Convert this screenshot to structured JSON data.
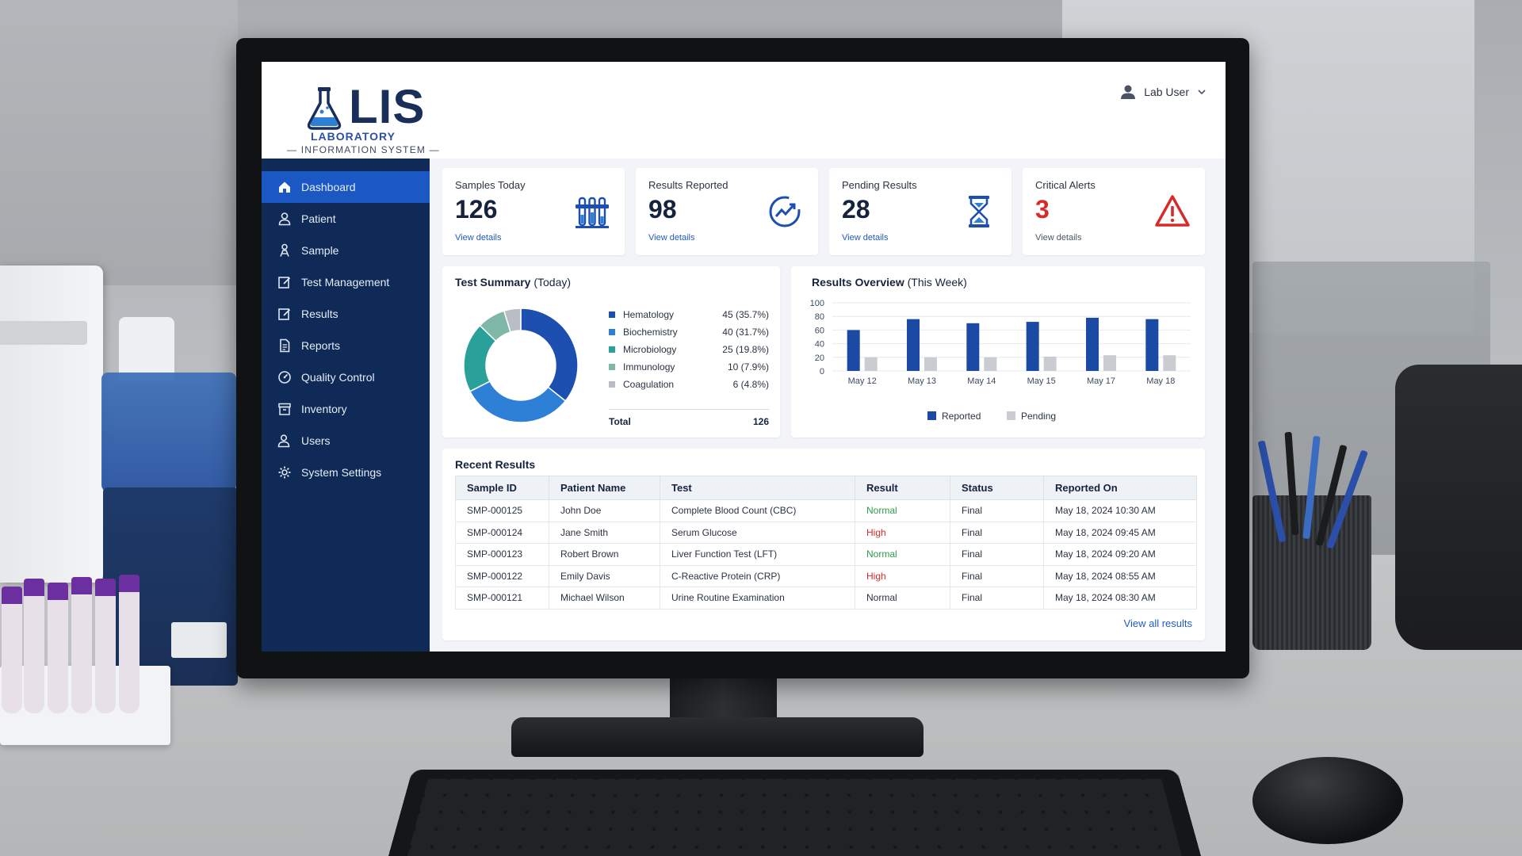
{
  "app": {
    "logo_text": "LIS",
    "logo_subtitle_1": "LABORATORY",
    "logo_subtitle_2": "INFORMATION SYSTEM"
  },
  "user": {
    "name": "Lab User",
    "icon": "user-icon",
    "menu_icon": "chevron-down-icon"
  },
  "sidebar": {
    "items": [
      {
        "label": "Dashboard",
        "icon": "home-icon",
        "active": true
      },
      {
        "label": "Patient",
        "icon": "user-icon"
      },
      {
        "label": "Sample",
        "icon": "sample-icon"
      },
      {
        "label": "Test Management",
        "icon": "edit-icon"
      },
      {
        "label": "Results",
        "icon": "edit-icon"
      },
      {
        "label": "Reports",
        "icon": "document-icon"
      },
      {
        "label": "Quality Control",
        "icon": "gauge-icon"
      },
      {
        "label": "Inventory",
        "icon": "archive-icon"
      },
      {
        "label": "Users",
        "icon": "users-icon"
      },
      {
        "label": "System Settings",
        "icon": "gear-icon"
      }
    ]
  },
  "kpis": [
    {
      "title": "Samples Today",
      "value": "126",
      "link": "View details",
      "icon": "test-tubes-icon"
    },
    {
      "title": "Results Reported",
      "value": "98",
      "link": "View details",
      "icon": "chart-check-icon"
    },
    {
      "title": "Pending Results",
      "value": "28",
      "link": "View details",
      "icon": "hourglass-icon"
    },
    {
      "title": "Critical Alerts",
      "value": "3",
      "link": "View details",
      "icon": "warning-icon"
    }
  ],
  "test_summary": {
    "title": "Test Summary",
    "title_suffix": "(Today)",
    "rows": [
      {
        "name": "Hematology",
        "value": "45 (35.7%)",
        "color": "#1c4fb0"
      },
      {
        "name": "Biochemistry",
        "value": "40 (31.7%)",
        "color": "#2e7fd6"
      },
      {
        "name": "Microbiology",
        "value": "25 (19.8%)",
        "color": "#2aa198"
      },
      {
        "name": "Immunology",
        "value": "10 (7.9%)",
        "color": "#7fb8a6"
      },
      {
        "name": "Coagulation",
        "value": "6 (4.8%)",
        "color": "#b9bec6"
      }
    ],
    "total_label": "Total",
    "total_value": "126"
  },
  "results_overview": {
    "title": "Results Overview",
    "title_suffix": "(This Week)",
    "legend": [
      {
        "name": "Reported",
        "color": "#1a4aa3"
      },
      {
        "name": "Pending",
        "color": "#c9ccd1"
      }
    ]
  },
  "chart_data": [
    {
      "type": "pie",
      "title": "Test Summary (Today)",
      "categories": [
        "Hematology",
        "Biochemistry",
        "Microbiology",
        "Immunology",
        "Coagulation"
      ],
      "values": [
        45,
        40,
        25,
        10,
        6
      ],
      "legend": "right"
    },
    {
      "type": "bar",
      "title": "Results Overview (This Week)",
      "categories": [
        "May 12",
        "May 13",
        "May 14",
        "May 15",
        "May 17",
        "May 18"
      ],
      "series": [
        {
          "name": "Reported",
          "values": [
            60,
            76,
            70,
            72,
            78,
            76
          ]
        },
        {
          "name": "Pending",
          "values": [
            20,
            20,
            20,
            21,
            23,
            23
          ]
        }
      ],
      "ylim": [
        0,
        100
      ],
      "yticks": [
        "0",
        "20",
        "40",
        "60",
        "80",
        "100"
      ],
      "grid": true,
      "legend": "bottom"
    }
  ],
  "recent_results": {
    "title": "Recent Results",
    "columns": [
      "Sample ID",
      "Patient Name",
      "Test",
      "Result",
      "Status",
      "Reported On"
    ],
    "rows": [
      {
        "sample_id": "SMP-000125",
        "patient": "John Doe",
        "test": "Complete Blood Count (CBC)",
        "result": "Normal",
        "result_style": "normal",
        "status": "Final",
        "reported_on": "May 18, 2024 10:30 AM"
      },
      {
        "sample_id": "SMP-000124",
        "patient": "Jane Smith",
        "test": "Serum Glucose",
        "result": "High",
        "result_style": "high",
        "status": "Final",
        "reported_on": "May 18, 2024 09:45 AM"
      },
      {
        "sample_id": "SMP-000123",
        "patient": "Robert Brown",
        "test": "Liver Function Test (LFT)",
        "result": "Normal",
        "result_style": "normal",
        "status": "Final",
        "reported_on": "May 18, 2024 09:20 AM"
      },
      {
        "sample_id": "SMP-000122",
        "patient": "Emily Davis",
        "test": "C-Reactive Protein (CRP)",
        "result": "High",
        "result_style": "high",
        "status": "Final",
        "reported_on": "May 18, 2024 08:55 AM"
      },
      {
        "sample_id": "SMP-000121",
        "patient": "Michael Wilson",
        "test": "Urine Routine Examination",
        "result": "Normal",
        "result_style": "plain",
        "status": "Final",
        "reported_on": "May 18, 2024 08:30 AM"
      }
    ],
    "view_all": "View all results"
  },
  "colors": {
    "sidebar_bg": "#0f2a57",
    "active_item": "#1b58c4",
    "accent_link": "#1f5ac9",
    "critical": "#d52b2b",
    "normal": "#2e9d48"
  }
}
